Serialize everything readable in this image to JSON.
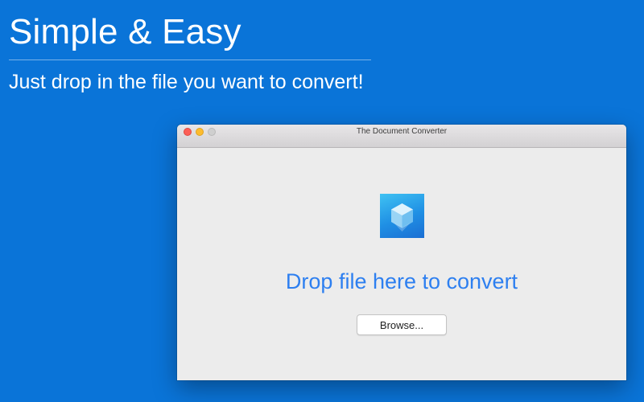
{
  "promo": {
    "headline": "Simple & Easy",
    "subheadline": "Just drop in the file you want to convert!"
  },
  "window": {
    "title": "The Document Converter",
    "drop_prompt": "Drop file here to convert",
    "browse_label": "Browse...",
    "app_icon": "cube-icon"
  },
  "colors": {
    "background": "#0a74d8",
    "accent_text": "#2d7ff0",
    "window_bg": "#ececec"
  }
}
